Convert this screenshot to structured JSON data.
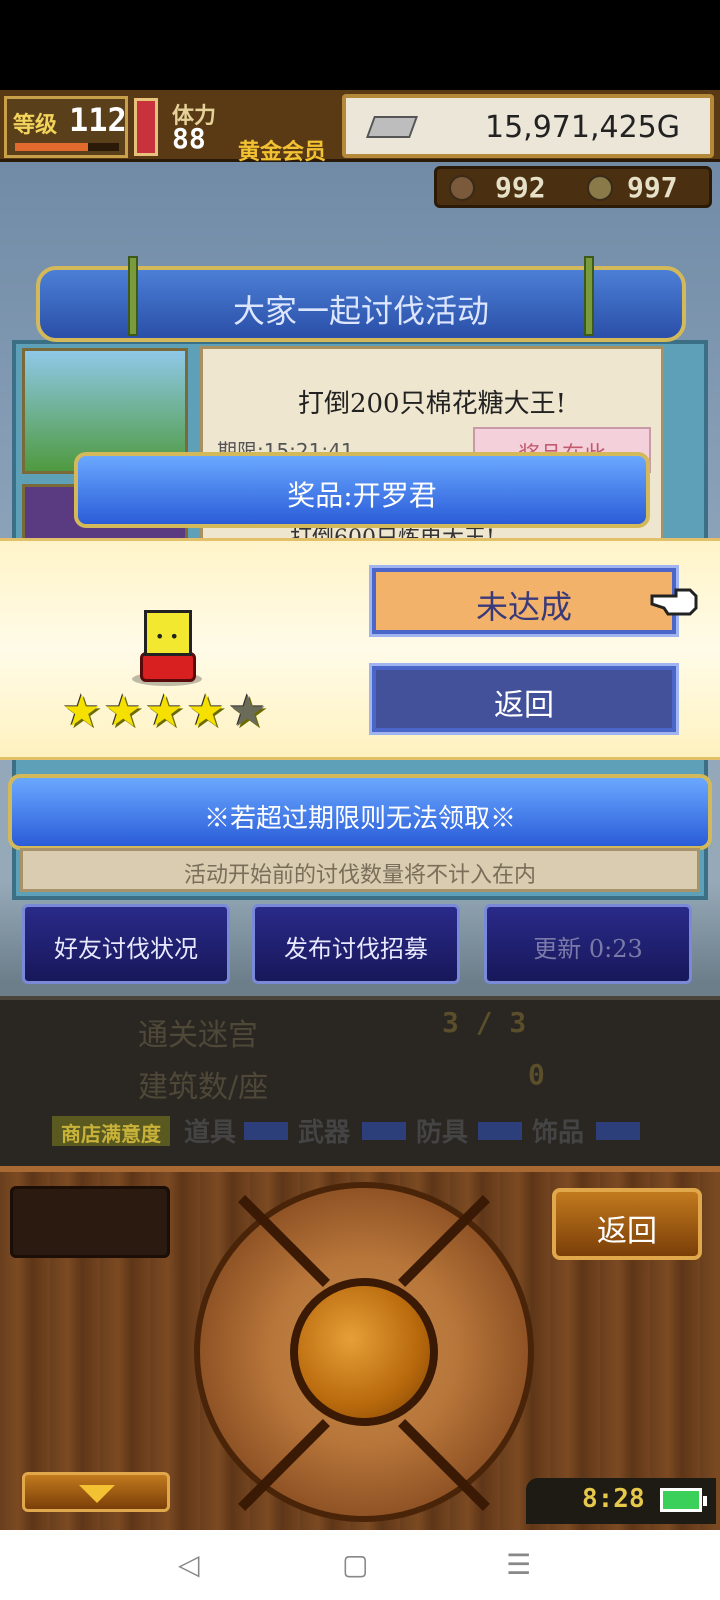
{
  "hud": {
    "level_label": "等级",
    "level": "112",
    "level_progress_percent": 70,
    "stamina_label": "体力",
    "stamina": "88",
    "membership": "黄金会员",
    "gold": "15,971,425G",
    "gem_a": "992",
    "gem_b": "997"
  },
  "event": {
    "title": "大家一起讨伐活动",
    "goal": "打倒200只棉花糖大王!",
    "period": "期限:15:21:41",
    "prize_tag": "奖品在此",
    "peek_text": "打倒600只炼电大王!"
  },
  "prize_banner": "奖品:开罗君",
  "dialog": {
    "rating_stars": 4,
    "rating_max": 5,
    "unachieved_label": "未达成",
    "return_label": "返回"
  },
  "warning": "※若超过期限则无法领取※",
  "note": "活动开始前的讨伐数量将不计入在内",
  "nav": {
    "friends_label": "好友讨伐状况",
    "recruit_label": "发布讨伐招募",
    "refresh_label": "更新 0:23"
  },
  "stats": {
    "dungeon_label": "通关迷宫",
    "dungeon_value": "3 / 3",
    "buildings_label": "建筑数/座",
    "buildings_value": "0",
    "shop_label": "商店满意度",
    "cat_items": "道具",
    "cat_weapons": "武器",
    "cat_armor": "防具",
    "cat_accessories": "饰品"
  },
  "controller": {
    "return_label": "返回",
    "clock": "8:28"
  },
  "system_nav": {
    "back": "◁",
    "home": "▢",
    "menu": "☰"
  }
}
